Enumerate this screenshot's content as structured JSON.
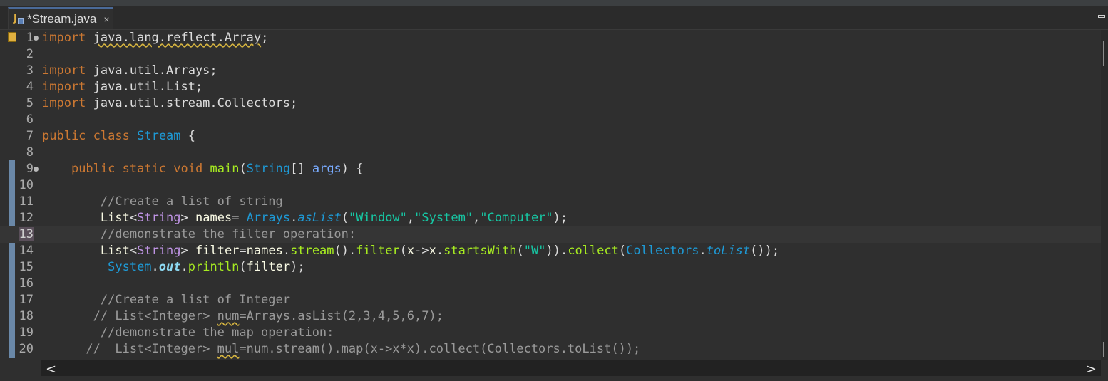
{
  "tab": {
    "title": "*Stream.java",
    "close_glyph": "×",
    "icon": "java-file-icon"
  },
  "lines": [
    {
      "num": "1",
      "fold": true,
      "tokens": [
        [
          "kw",
          "import"
        ],
        [
          "pl",
          " "
        ],
        [
          "squig",
          "java.lang.reflect.Array"
        ],
        [
          "pl",
          ";"
        ]
      ]
    },
    {
      "num": "2",
      "tokens": []
    },
    {
      "num": "3",
      "tokens": [
        [
          "kw",
          "import"
        ],
        [
          "pl",
          " java.util.Arrays;"
        ]
      ]
    },
    {
      "num": "4",
      "tokens": [
        [
          "kw",
          "import"
        ],
        [
          "pl",
          " java.util.List;"
        ]
      ]
    },
    {
      "num": "5",
      "tokens": [
        [
          "kw",
          "import"
        ],
        [
          "pl",
          " java.util.stream.Collectors;"
        ]
      ]
    },
    {
      "num": "6",
      "tokens": []
    },
    {
      "num": "7",
      "tokens": [
        [
          "kw",
          "public"
        ],
        [
          "pl",
          " "
        ],
        [
          "kw",
          "class"
        ],
        [
          "pl",
          " "
        ],
        [
          "ty",
          "Stream"
        ],
        [
          "pl",
          " {"
        ]
      ]
    },
    {
      "num": "8",
      "tokens": []
    },
    {
      "num": "9",
      "fold": true,
      "tokens": [
        [
          "pl",
          "    "
        ],
        [
          "kw",
          "public"
        ],
        [
          "pl",
          " "
        ],
        [
          "kw",
          "static"
        ],
        [
          "pl",
          " "
        ],
        [
          "kw",
          "void"
        ],
        [
          "pl",
          " "
        ],
        [
          "fn",
          "main"
        ],
        [
          "pl",
          "("
        ],
        [
          "ty",
          "String"
        ],
        [
          "pl",
          "[] "
        ],
        [
          "vx",
          "args"
        ],
        [
          "pl",
          ") {"
        ]
      ]
    },
    {
      "num": "10",
      "tokens": []
    },
    {
      "num": "11",
      "tokens": [
        [
          "pl",
          "        "
        ],
        [
          "cm",
          "//Create a list of string"
        ]
      ]
    },
    {
      "num": "12",
      "tokens": [
        [
          "pl",
          "        "
        ],
        [
          "id",
          "List"
        ],
        [
          "pl",
          "<"
        ],
        [
          "gn",
          "String"
        ],
        [
          "pl",
          "> "
        ],
        [
          "id",
          "names"
        ],
        [
          "pl",
          "= "
        ],
        [
          "ty",
          "Arrays"
        ],
        [
          "pl",
          "."
        ],
        [
          "sm",
          "asList"
        ],
        [
          "pl",
          "("
        ],
        [
          "str",
          "\"Window\""
        ],
        [
          "pl",
          ","
        ],
        [
          "str",
          "\"System\""
        ],
        [
          "pl",
          ","
        ],
        [
          "str",
          "\"Computer\""
        ],
        [
          "pl",
          ");"
        ]
      ]
    },
    {
      "num": "13",
      "current": true,
      "tokens": [
        [
          "pl",
          "        "
        ],
        [
          "cm",
          "//demonstrate the filter operation:"
        ]
      ]
    },
    {
      "num": "14",
      "tokens": [
        [
          "pl",
          "        "
        ],
        [
          "id",
          "List"
        ],
        [
          "pl",
          "<"
        ],
        [
          "gn",
          "String"
        ],
        [
          "pl",
          "> "
        ],
        [
          "id",
          "filter"
        ],
        [
          "pl",
          "="
        ],
        [
          "id",
          "names"
        ],
        [
          "pl",
          "."
        ],
        [
          "fn",
          "stream"
        ],
        [
          "pl",
          "()."
        ],
        [
          "fn",
          "filter"
        ],
        [
          "pl",
          "("
        ],
        [
          "id",
          "x"
        ],
        [
          "pl",
          "->"
        ],
        [
          "id",
          "x"
        ],
        [
          "pl",
          "."
        ],
        [
          "fn",
          "startsWith"
        ],
        [
          "pl",
          "("
        ],
        [
          "str",
          "\"W\""
        ],
        [
          "pl",
          "))."
        ],
        [
          "fn",
          "collect"
        ],
        [
          "pl",
          "("
        ],
        [
          "ty",
          "Collectors"
        ],
        [
          "pl",
          "."
        ],
        [
          "sm",
          "toList"
        ],
        [
          "pl",
          "());"
        ]
      ]
    },
    {
      "num": "15",
      "tokens": [
        [
          "pl",
          "         "
        ],
        [
          "ty",
          "System"
        ],
        [
          "pl",
          "."
        ],
        [
          "fd",
          "out"
        ],
        [
          "pl",
          "."
        ],
        [
          "fn",
          "println"
        ],
        [
          "pl",
          "("
        ],
        [
          "id",
          "filter"
        ],
        [
          "pl",
          ");"
        ]
      ]
    },
    {
      "num": "16",
      "tokens": []
    },
    {
      "num": "17",
      "tokens": [
        [
          "pl",
          "        "
        ],
        [
          "cm",
          "//Create a list of Integer"
        ]
      ]
    },
    {
      "num": "18",
      "tokens": [
        [
          "pl",
          "       "
        ],
        [
          "cm",
          "// List<Integer> "
        ],
        [
          "cmsq",
          "num"
        ],
        [
          "cm",
          "=Arrays.asList(2,3,4,5,6,7);"
        ]
      ]
    },
    {
      "num": "19",
      "tokens": [
        [
          "pl",
          "        "
        ],
        [
          "cm",
          "//demonstrate the map operation:"
        ]
      ]
    },
    {
      "num": "20",
      "tokens": [
        [
          "pl",
          "      "
        ],
        [
          "cm",
          "//  List<Integer> "
        ],
        [
          "cmsq",
          "mul"
        ],
        [
          "cm",
          "=num.stream().map(x->x*x).collect(Collectors.toList());"
        ]
      ]
    }
  ],
  "scroll": {
    "left_arrow": "<",
    "right_arrow": ">"
  }
}
